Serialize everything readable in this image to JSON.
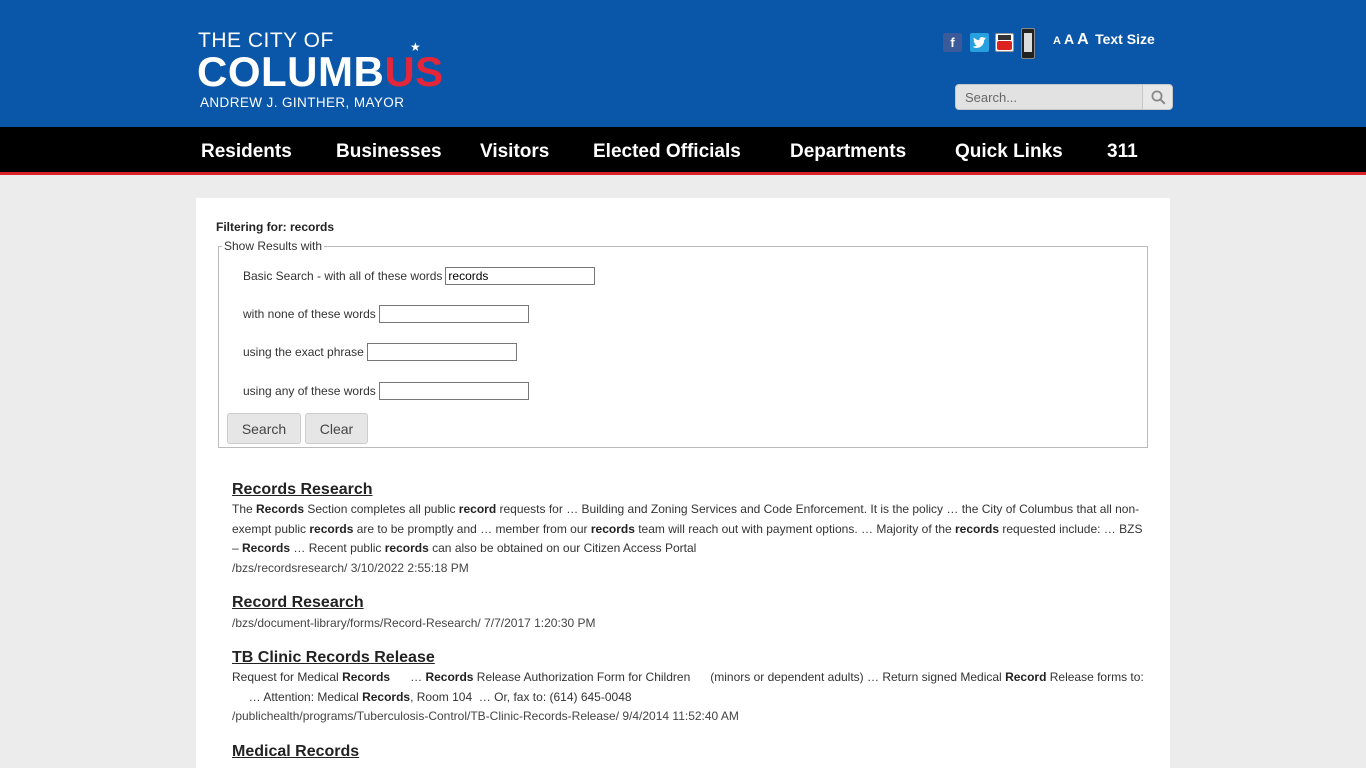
{
  "header": {
    "logo_line1": "THE CITY OF",
    "logo_line2_a": "COLUMB",
    "logo_line2_b": "US",
    "logo_line3": "ANDREW J. GINTHER, MAYOR",
    "social_icons": [
      "facebook-icon",
      "twitter-icon",
      "youtube-icon",
      "mobile-app-icon"
    ],
    "text_size": {
      "a_small": "A",
      "a_medium": "A",
      "a_large": "A",
      "label": "Text Size"
    },
    "search_placeholder": "Search...",
    "brand_blue": "#0a56a8",
    "brand_red": "#e3263a"
  },
  "nav": {
    "items": [
      "Residents",
      "Businesses",
      "Visitors",
      "Elected Officials",
      "Departments",
      "Quick Links",
      "311"
    ]
  },
  "filter": {
    "title": "Filtering for: records",
    "legend": "Show Results with",
    "basic_label": "Basic Search - with all of these words",
    "basic_value": "records",
    "none_label": "with none of these words",
    "none_value": "",
    "exact_label": "using the exact phrase",
    "exact_value": "",
    "any_label": "using any of these words",
    "any_value": "",
    "search_button": "Search",
    "clear_button": "Clear"
  },
  "results": [
    {
      "title": "Records Research",
      "snippet_html": "The <b>Records</b> Section completes all public <b>record</b> requests for … Building and Zoning Services and Code Enforcement. It is the policy … the City of Columbus that all non-exempt public <b>records</b> are to be promptly and … member from our <b>records</b> team will reach out with payment options. … Majority of the <b>records</b> requested include: … BZS – <b>Records</b> … Recent public <b>records</b> can also be obtained on our Citizen Access Portal",
      "url_line": "/bzs/recordsresearch/ 3/10/2022 2:55:18 PM"
    },
    {
      "title": "Record Research",
      "snippet_html": "",
      "url_line": "/bzs/document-library/forms/Record-Research/ 7/7/2017 1:20:30 PM"
    },
    {
      "title": "TB Clinic Records Release",
      "snippet_html": "Request for Medical <b>Records</b> &nbsp;&nbsp;&nbsp;&nbsp; … <b>Records</b> Release Authorization Form for Children &nbsp;&nbsp;&nbsp;&nbsp; (minors or dependent adults) … Return signed Medical <b>Record</b> Release forms to: &nbsp;&nbsp;&nbsp;&nbsp; … Attention: Medical <b>Records</b>, Room 104 &nbsp;… Or, fax to: (614) 645-0048",
      "url_line": "/publichealth/programs/Tuberculosis-Control/TB-Clinic-Records-Release/ 9/4/2014 11:52:40 AM"
    },
    {
      "title": "Medical Records",
      "snippet_html": "",
      "url_line": ""
    }
  ]
}
